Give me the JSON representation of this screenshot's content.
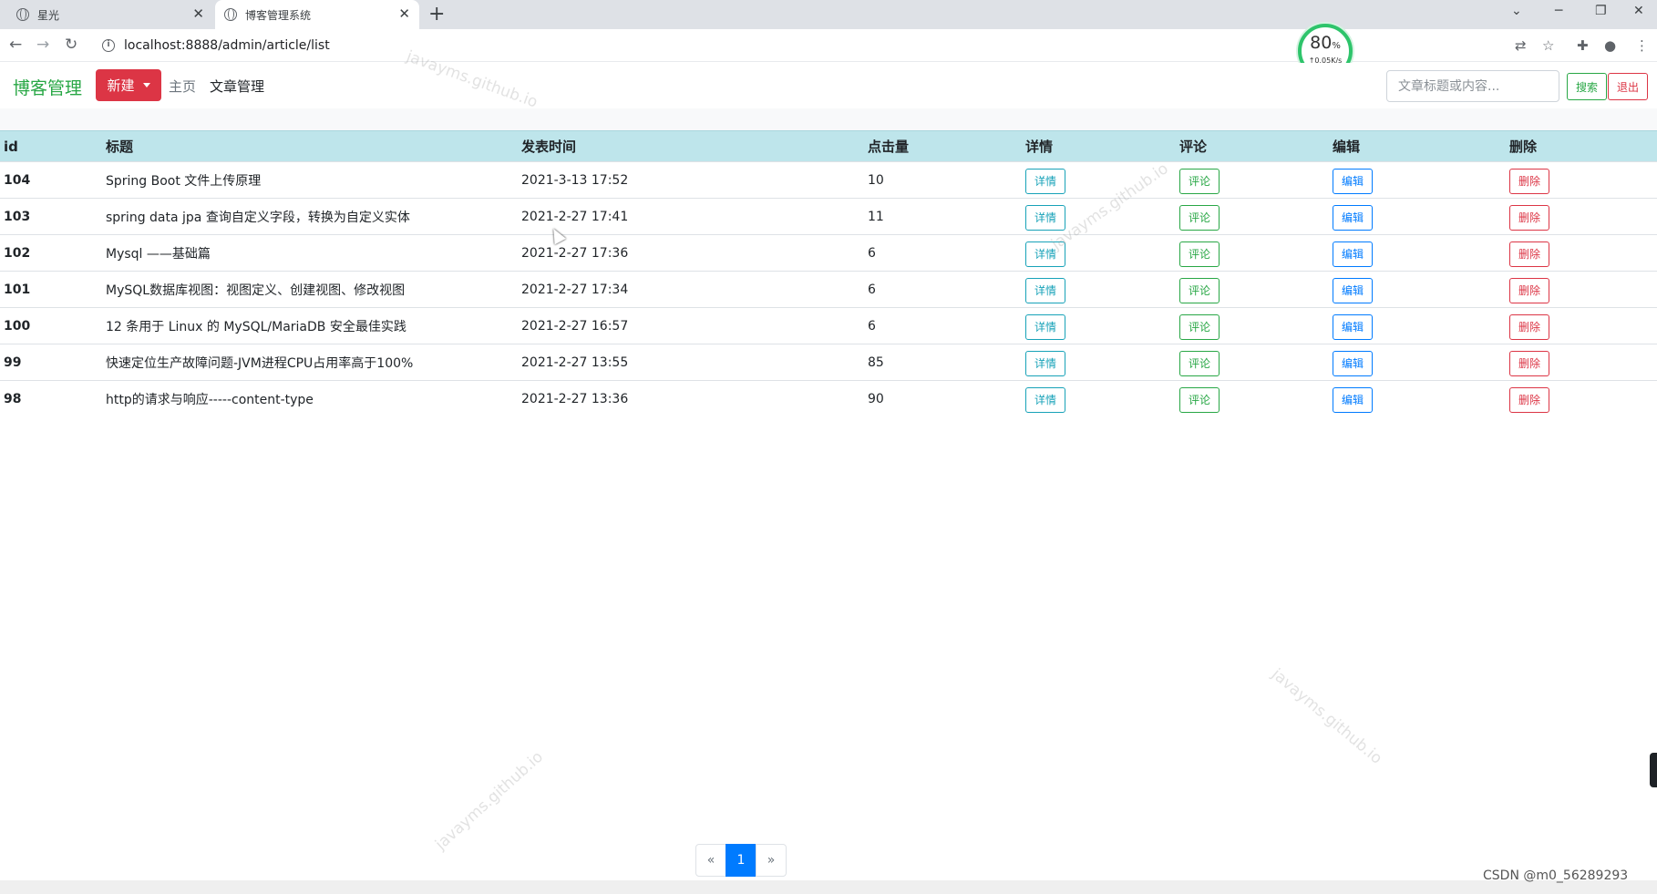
{
  "browser": {
    "tabs": [
      {
        "title": "星光",
        "active": false
      },
      {
        "title": "博客管理系统",
        "active": true
      }
    ],
    "url": "localhost:8888/admin/article/list",
    "speed_widget": {
      "percent": "80",
      "percent_sign": "%",
      "rate": "↑0.05K/s"
    }
  },
  "app": {
    "brand": "博客管理",
    "new_button": "新建",
    "nav": {
      "home": "主页",
      "articles": "文章管理"
    },
    "search": {
      "placeholder": "文章标题或内容...",
      "value": ""
    },
    "search_button": "搜索",
    "logout_button": "退出"
  },
  "table": {
    "headers": [
      "id",
      "标题",
      "发表时间",
      "点击量",
      "详情",
      "评论",
      "编辑",
      "删除"
    ],
    "action_labels": {
      "detail": "详情",
      "comment": "评论",
      "edit": "编辑",
      "delete": "删除"
    },
    "rows": [
      {
        "id": "104",
        "title": "Spring Boot 文件上传原理",
        "time": "2021-3-13 17:52",
        "clicks": "10"
      },
      {
        "id": "103",
        "title": "spring data jpa 查询自定义字段，转换为自定义实体",
        "time": "2021-2-27 17:41",
        "clicks": "11"
      },
      {
        "id": "102",
        "title": "Mysql ——基础篇",
        "time": "2021-2-27 17:36",
        "clicks": "6"
      },
      {
        "id": "101",
        "title": "MySQL数据库视图：视图定义、创建视图、修改视图",
        "time": "2021-2-27 17:34",
        "clicks": "6"
      },
      {
        "id": "100",
        "title": "12 条用于 Linux 的 MySQL/MariaDB 安全最佳实践",
        "time": "2021-2-27 16:57",
        "clicks": "6"
      },
      {
        "id": "99",
        "title": "快速定位生产故障问题-JVM进程CPU占用率高于100%",
        "time": "2021-2-27 13:55",
        "clicks": "85"
      },
      {
        "id": "98",
        "title": "http的请求与响应-----content-type",
        "time": "2021-2-27 13:36",
        "clicks": "90"
      }
    ]
  },
  "pagination": {
    "prev": "«",
    "current": "1",
    "next": "»"
  },
  "watermark": "javayms.github.io",
  "csdn_mark": "CSDN @m0_56289293",
  "colors": {
    "brand": "#28a745",
    "danger": "#dc3545",
    "primary": "#007bff",
    "info": "#17a2b8",
    "table_head": "#bee5eb"
  }
}
